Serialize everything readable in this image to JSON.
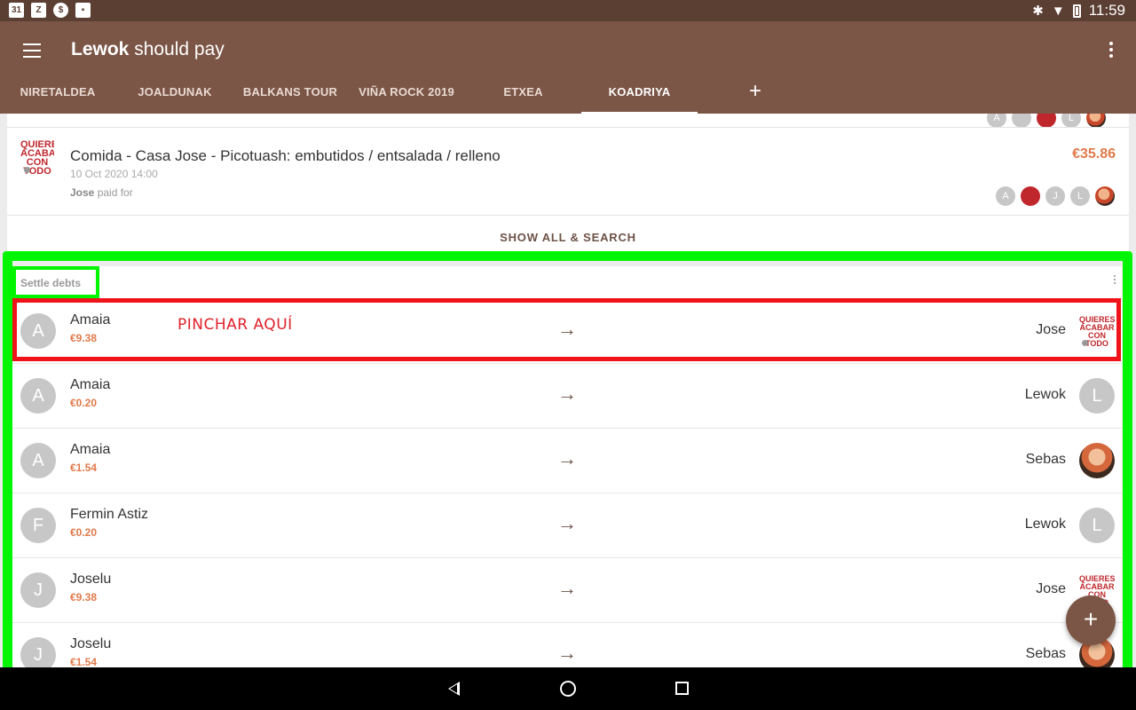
{
  "status_bar": {
    "left_icons": [
      "calendar-icon",
      "z-app-icon",
      "dollar-icon",
      "image-icon"
    ],
    "calendar_day": "31",
    "time": "11:59"
  },
  "app_bar": {
    "title_bold": "Lewok",
    "title_rest": " should pay"
  },
  "tabs": [
    {
      "label": "NIRETALDEA"
    },
    {
      "label": "JOALDUNAK"
    },
    {
      "label": "BALKANS TOUR"
    },
    {
      "label": "VIÑA ROCK 2019"
    },
    {
      "label": "ETXEA"
    },
    {
      "label": "KOADRIYA",
      "active": true
    }
  ],
  "tab_add_label": "+",
  "top_mini_avatars": [
    "A",
    "L"
  ],
  "expense": {
    "title": "Comida - Casa Jose - Picotuash:  embutidos / entsalada / relleno",
    "date": "10 Oct 2020 14:00",
    "payer": "Jose",
    "paid_for_text": " paid for",
    "amount": "€35.86",
    "participants": [
      "A",
      "J",
      "L"
    ]
  },
  "show_all_label": "SHOW ALL & SEARCH",
  "settle": {
    "label": "Settle debts",
    "rows": [
      {
        "from_initial": "A",
        "from": "Amaia",
        "amount": "€9.38",
        "to": "Jose",
        "to_avatar": "logo"
      },
      {
        "from_initial": "A",
        "from": "Amaia",
        "amount": "€0.20",
        "to": "Lewok",
        "to_initial": "L"
      },
      {
        "from_initial": "A",
        "from": "Amaia",
        "amount": "€1.54",
        "to": "Sebas",
        "to_avatar": "photo"
      },
      {
        "from_initial": "F",
        "from": "Fermin Astiz",
        "amount": "€0.20",
        "to": "Lewok",
        "to_initial": "L"
      },
      {
        "from_initial": "J",
        "from": "Joselu",
        "amount": "€9.38",
        "to": "Jose",
        "to_avatar": "logo"
      },
      {
        "from_initial": "J",
        "from": "Joselu",
        "amount": "€1.54",
        "to": "Sebas",
        "to_avatar": "photo"
      }
    ]
  },
  "logo_text": "QUIERES ACABAR CON TODO",
  "annotation": "PINCHAR AQUÍ",
  "arrow_glyph": "→",
  "fab_label": "+",
  "colors": {
    "status_bar": "#5c3f33",
    "app_bar": "#7b5546",
    "amount": "#e07a4a",
    "highlight_green": "#00f600",
    "highlight_red": "#f0141a"
  }
}
